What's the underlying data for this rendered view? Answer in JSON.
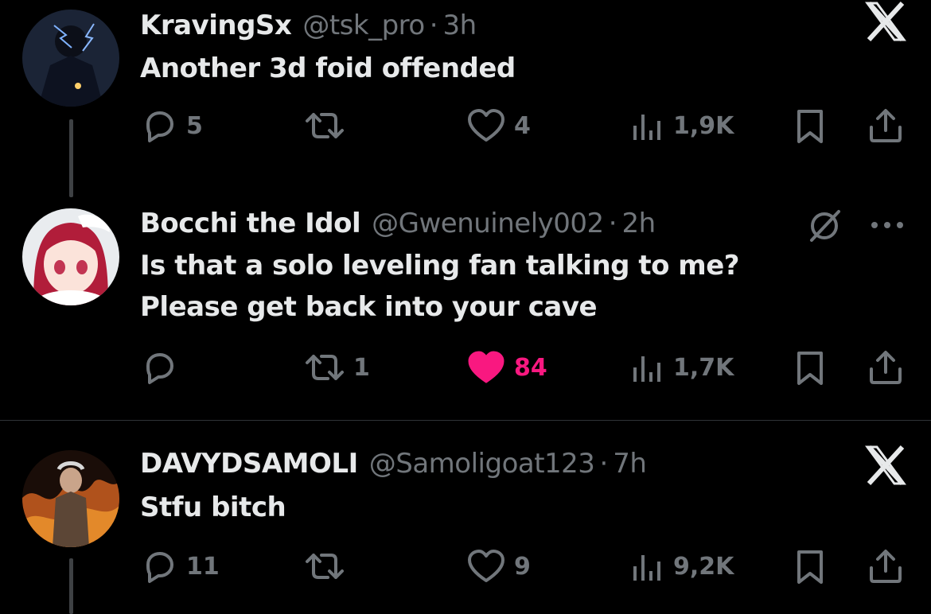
{
  "tweets": [
    {
      "name": "KravingSx",
      "handle": "@tsk_pro",
      "time": "3h",
      "text_lines": [
        "Another 3d foid offended"
      ],
      "replies": "5",
      "retweets": "",
      "likes": "4",
      "views": "1,9K",
      "liked": false,
      "badge": "X"
    },
    {
      "name": "Bocchi the Idol",
      "handle": "@Gwenuinely002",
      "time": "2h",
      "text_lines": [
        "Is that a solo leveling fan talking to me?",
        "Please get back into your cave"
      ],
      "replies": "",
      "retweets": "1",
      "likes": "84",
      "views": "1,7K",
      "liked": true,
      "badge": "grok"
    },
    {
      "name": "DAVYDSAMOLI",
      "handle": "@Samoligoat123",
      "time": "7h",
      "text_lines": [
        "Stfu bitch"
      ],
      "replies": "11",
      "retweets": "",
      "likes": "9",
      "views": "9,2K",
      "liked": false,
      "badge": "X"
    }
  ],
  "separator": "·",
  "colors": {
    "background": "#000000",
    "muted": "#71767b",
    "text": "#e7e9ea",
    "like": "#f91880"
  }
}
